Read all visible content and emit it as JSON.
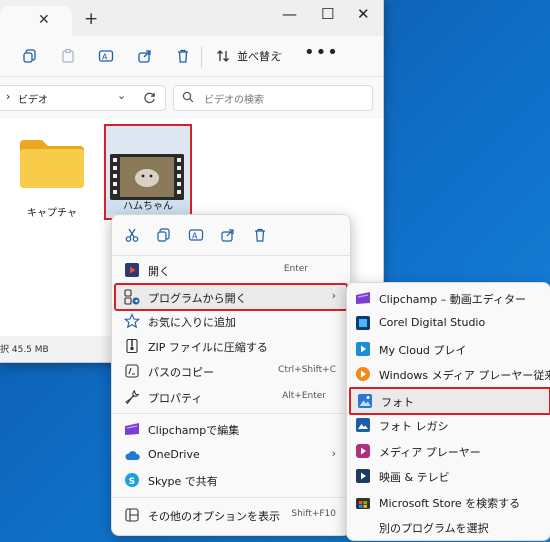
{
  "window": {
    "tab_close": "✕",
    "new_tab": "+",
    "minimize": "—",
    "maximize": "☐",
    "close": "✕"
  },
  "toolbar": {
    "sort_label": "並べ替え",
    "more": "•••"
  },
  "address": {
    "chevron": "›",
    "path": "ビデオ",
    "search_placeholder": "ビデオの検索"
  },
  "files": [
    {
      "name": "キャプチャ",
      "type": "folder-icon"
    },
    {
      "name": "ハムちゃん",
      "type": "video-icon"
    }
  ],
  "status": {
    "text": "択  45.5 MB"
  },
  "context_menu": {
    "top_icons": [
      "cut-icon",
      "copy-icon",
      "rename-icon",
      "share-icon",
      "delete-icon"
    ],
    "items": [
      {
        "label": "開く",
        "shortcut": "Enter",
        "icon": "open-icon"
      },
      {
        "label": "プログラムから開く",
        "arrow": "›",
        "icon": "open-with-icon",
        "highlight": true
      },
      {
        "label": "お気に入りに追加",
        "icon": "star-icon"
      },
      {
        "label": "ZIP ファイルに圧縮する",
        "icon": "zip-icon"
      },
      {
        "label": "パスのコピー",
        "shortcut": "Ctrl+Shift+C",
        "icon": "path-copy-icon"
      },
      {
        "label": "プロパティ",
        "shortcut": "Alt+Enter",
        "icon": "wrench-icon"
      },
      {
        "label": "Clipchampで編集",
        "icon": "clipchamp-icon"
      },
      {
        "label": "OneDrive",
        "arrow": "›",
        "icon": "cloud-icon"
      },
      {
        "label": "Skype で共有",
        "icon": "skype-icon"
      },
      {
        "label": "その他のオプションを表示",
        "shortcut": "Shift+F10",
        "icon": "more-options-icon"
      }
    ]
  },
  "submenu": {
    "items": [
      {
        "label": "Clipchamp – 動画エディター",
        "icon": "clipchamp-icon"
      },
      {
        "label": "Corel Digital Studio",
        "icon": "corel-icon"
      },
      {
        "label": "My Cloud プレイ",
        "icon": "mycloud-icon"
      },
      {
        "label": "Windows メディア プレーヤー従来版",
        "icon": "wmp-icon"
      },
      {
        "label": "フォト",
        "icon": "photos-icon",
        "highlight": true
      },
      {
        "label": "フォト レガシ",
        "icon": "photos-legacy-icon"
      },
      {
        "label": "メディア プレーヤー",
        "icon": "media-player-icon"
      },
      {
        "label": "映画 & テレビ",
        "icon": "movies-tv-icon"
      },
      {
        "label": "Microsoft Store を検索する",
        "icon": "store-icon"
      },
      {
        "label": "別のプログラムを選択",
        "icon": ""
      }
    ]
  },
  "colors": {
    "highlight_border": "#d6202a",
    "desktop": "#0a5fb0"
  }
}
